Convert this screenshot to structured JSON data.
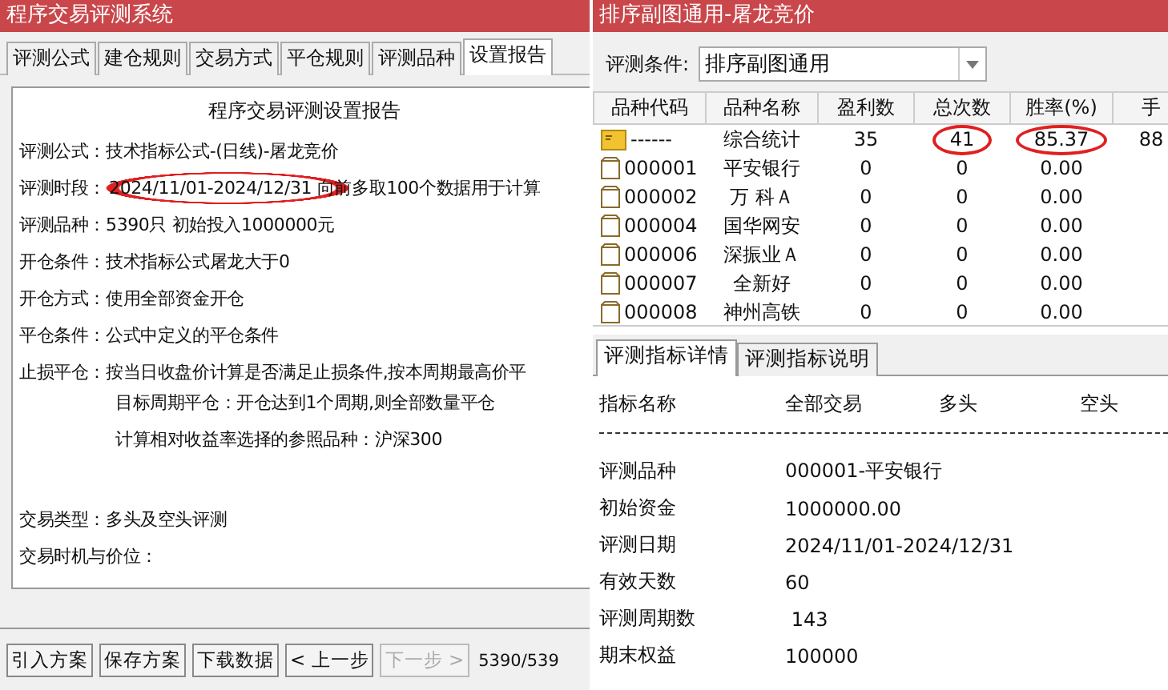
{
  "left_window": {
    "title": "程序交易评测系统",
    "tabs": [
      {
        "label": "评测公式",
        "selected": false
      },
      {
        "label": "建仓规则",
        "selected": false
      },
      {
        "label": "交易方式",
        "selected": false
      },
      {
        "label": "平仓规则",
        "selected": false
      },
      {
        "label": "评测品种",
        "selected": false
      },
      {
        "label": "设置报告",
        "selected": true
      }
    ],
    "report": {
      "heading": "程序交易评测设置报告",
      "lines": [
        {
          "kind": "field",
          "label": "评测公式：",
          "value": "技术指标公式-(日线)-屠龙竞价"
        },
        {
          "kind": "field",
          "label": "评测时段：",
          "value": "2024/11/01-2024/12/31 向前多取100个数据用于计算"
        },
        {
          "kind": "field",
          "label": "评测品种：",
          "value": "5390只 初始投入1000000元"
        },
        {
          "kind": "field",
          "label": "开仓条件：",
          "value": "技术指标公式屠龙大于0"
        },
        {
          "kind": "field",
          "label": "开仓方式：",
          "value": "使用全部资金开仓"
        },
        {
          "kind": "field",
          "label": "平仓条件：",
          "value": "公式中定义的平仓条件"
        },
        {
          "kind": "field",
          "label": "止损平仓：",
          "value": "按当日收盘价计算是否满足止损条件,按本周期最高价平"
        },
        {
          "kind": "indent",
          "value": "目标周期平仓：开仓达到1个周期,则全部数量平仓"
        },
        {
          "kind": "indent",
          "value": "计算相对收益率选择的参照品种：沪深300"
        },
        {
          "kind": "gap"
        },
        {
          "kind": "field",
          "label": "交易类型：",
          "value": "多头及空头评测"
        },
        {
          "kind": "field",
          "label": "交易时机与价位："
        }
      ]
    },
    "buttons": [
      {
        "label": "引入方案",
        "disabled": false
      },
      {
        "label": "保存方案",
        "disabled": false
      },
      {
        "label": "下载数据",
        "disabled": false
      },
      {
        "label": "< 上一步",
        "disabled": false
      },
      {
        "label": "下一步 >",
        "disabled": true
      }
    ],
    "counter": "5390/539"
  },
  "right_window": {
    "title": "排序副图通用-屠龙竞价",
    "condition_label": "评测条件:",
    "condition_value": "排序副图通用",
    "columns": [
      "品种代码",
      "品种名称",
      "盈利数",
      "总次数",
      "胜率(%)",
      "手"
    ],
    "rows": [
      {
        "kind": "summary",
        "cells": [
          "------",
          "综合统计",
          "35",
          "41",
          "85.37",
          "88"
        ]
      },
      {
        "kind": "stock",
        "cells": [
          "000001",
          "平安银行",
          "0",
          "0",
          "0.00"
        ]
      },
      {
        "kind": "stock",
        "cells": [
          "000002",
          "万 科Ａ",
          "0",
          "0",
          "0.00"
        ]
      },
      {
        "kind": "stock",
        "cells": [
          "000004",
          "国华网安",
          "0",
          "0",
          "0.00"
        ]
      },
      {
        "kind": "stock",
        "cells": [
          "000006",
          "深振业Ａ",
          "0",
          "0",
          "0.00"
        ]
      },
      {
        "kind": "stock",
        "cells": [
          "000007",
          "全新好",
          "0",
          "0",
          "0.00"
        ]
      },
      {
        "kind": "stock",
        "cells": [
          "000008",
          "神州高铁",
          "0",
          "0",
          "0.00"
        ]
      }
    ],
    "detail_tabs": [
      {
        "label": "评测指标详情",
        "selected": true
      },
      {
        "label": "评测指标说明",
        "selected": false
      }
    ],
    "detail_header": [
      "指标名称",
      "全部交易",
      "多头",
      "空头"
    ],
    "detail_rows": [
      {
        "label": "评测品种",
        "value": "000001-平安银行"
      },
      {
        "label": "初始资金",
        "value": "1000000.00"
      },
      {
        "label": "评测日期",
        "value": "2024/11/01-2024/12/31"
      },
      {
        "label": "有效天数",
        "value": "60"
      },
      {
        "label": "评测周期数",
        "value": " 143"
      },
      {
        "label": "期末权益",
        "value": "100000"
      }
    ]
  }
}
